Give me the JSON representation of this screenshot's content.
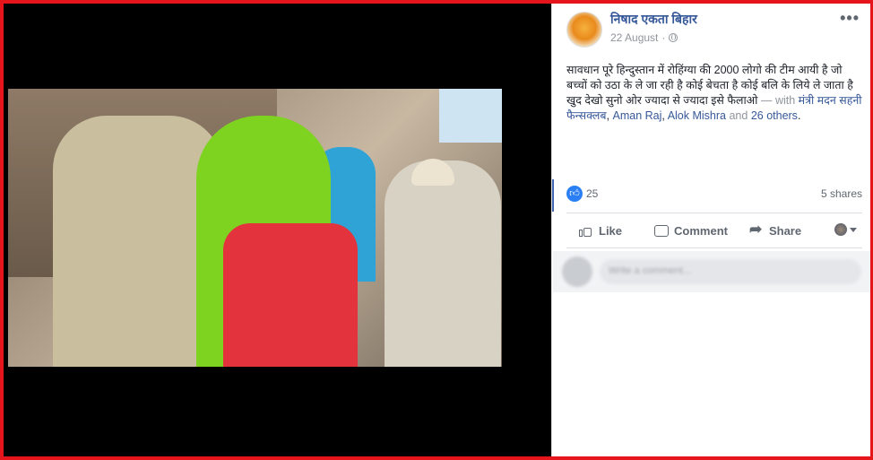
{
  "post": {
    "page_name": "निषाद एकता बिहार",
    "date": "22 August",
    "separator": "·",
    "more_label": "•••",
    "text": "सावधान पूरे हिन्दुस्तान में रोहिंग्या की 2000 लोगो की टीम आयी है जो बच्चों को उठा के ले जा रही है कोई बेचता है कोई बलि के लिये ले जाता है खुद देखो सुनो ओर ज्यादा से ज्यादा इसे फैलाओ",
    "with_label": "— with",
    "tagged": [
      "मंत्री मदन सहनी फैन्सक्लब",
      "Aman Raj",
      "Alok Mishra"
    ],
    "and_label": "and",
    "others": "26 others",
    "period": ".",
    "comma": ","
  },
  "stats": {
    "likes": "25",
    "shares": "5 shares"
  },
  "actions": {
    "like": "Like",
    "comment": "Comment",
    "share": "Share"
  },
  "comment_box": {
    "placeholder": "Write a comment..."
  },
  "colors": {
    "frame_border": "#e6141b",
    "link": "#365899",
    "like_badge": "#2b7ff5"
  }
}
